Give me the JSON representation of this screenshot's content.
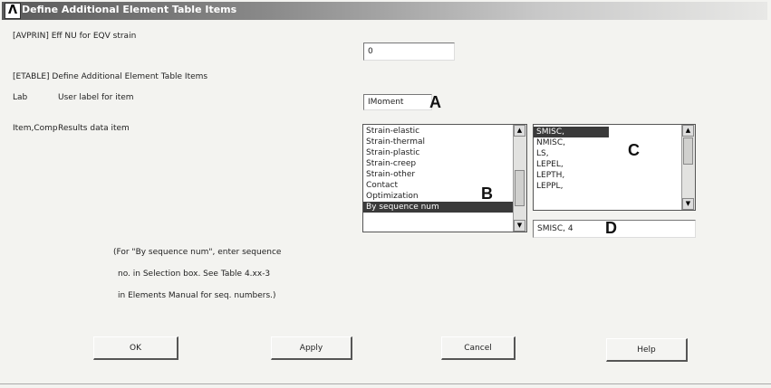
{
  "window": {
    "title": "Define Additional Element Table Items",
    "logo": "Λ"
  },
  "avprin": {
    "label": "[AVPRIN] Eff NU for EQV strain",
    "value": "0"
  },
  "etable": {
    "label": "[ETABLE] Define Additional Element Table Items"
  },
  "lab": {
    "label": "Lab",
    "description": "User label for item",
    "value": "IMoment"
  },
  "item_comp": {
    "label": "Item,Comp",
    "description": "Results data item"
  },
  "list_b": {
    "items": [
      "Strain-elastic",
      "Strain-thermal",
      "Strain-plastic",
      "Strain-creep",
      "Strain-other",
      "Contact",
      "Optimization",
      "By sequence num"
    ],
    "selected_index": 7
  },
  "list_c": {
    "items": [
      "SMISC,",
      "NMISC,",
      "LS,",
      "LEPEL,",
      "LEPTH,",
      "LEPPL,"
    ],
    "selected_index": 0
  },
  "selection_box": {
    "value": "SMISC, 4"
  },
  "markers": {
    "a": "A",
    "b": "B",
    "c": "C",
    "d": "D"
  },
  "note": {
    "line1": "(For \"By sequence num\", enter sequence",
    "line2": "no. in Selection box.  See Table 4.xx-3",
    "line3": "in Elements Manual for seq. numbers.)"
  },
  "buttons": {
    "ok": "OK",
    "apply": "Apply",
    "cancel": "Cancel",
    "help": "Help"
  }
}
